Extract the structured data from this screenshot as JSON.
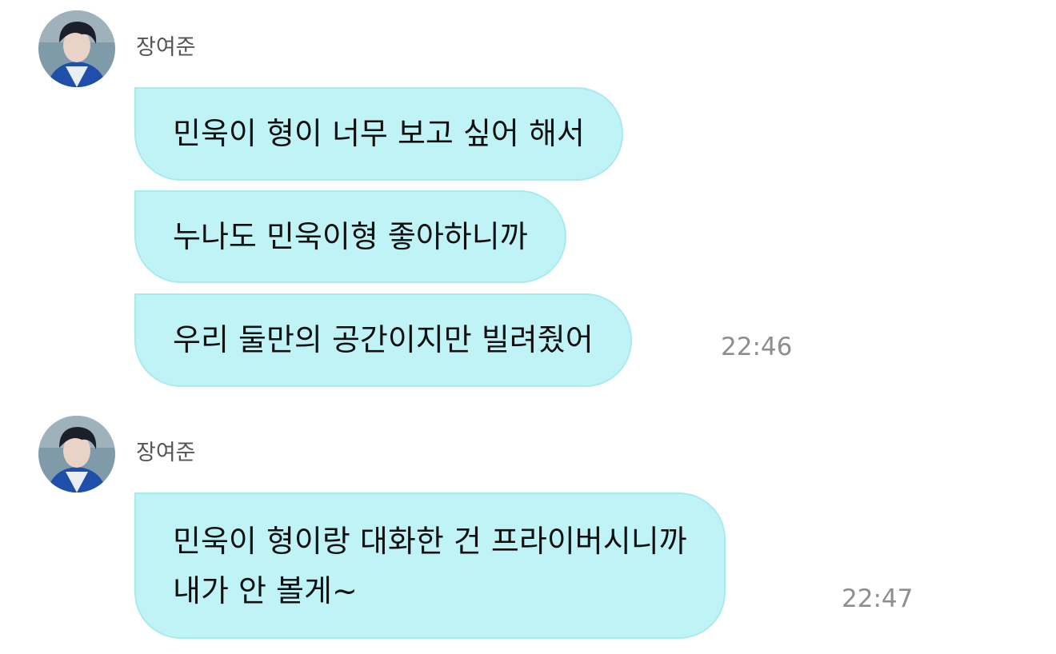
{
  "groups": [
    {
      "sender": "장여준",
      "messages": [
        {
          "lines": [
            "민욱이 형이 너무 보고 싶어 해서"
          ]
        },
        {
          "lines": [
            "누나도 민욱이형 좋아하니까"
          ]
        },
        {
          "lines": [
            "우리 둘만의 공간이지만 빌려줬어"
          ],
          "time": "22:46"
        }
      ]
    },
    {
      "sender": "장여준",
      "messages": [
        {
          "lines": [
            "민욱이 형이랑 대화한 건 프라이버시니까",
            "내가 안 볼게~"
          ],
          "time": "22:47"
        }
      ]
    }
  ],
  "icons": {
    "avatar": "profile-photo"
  },
  "colors": {
    "bubble": "#bff3f6",
    "bubble_border": "#a9eaef",
    "time": "#8e8e8e",
    "sender": "#555555"
  }
}
